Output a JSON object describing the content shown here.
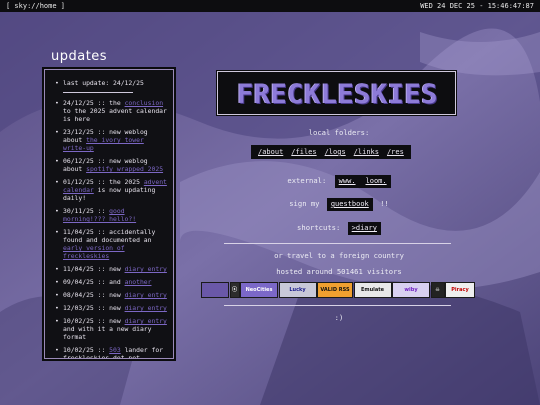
{
  "topbar": {
    "left": "[ sky://home ]",
    "right": "WED 24 DEC 25 - 15:46:47:87"
  },
  "sidebar": {
    "title": "updates",
    "last_update": "last update: 24/12/25",
    "items": [
      {
        "date": "24/12/25",
        "pre": " :: the ",
        "link": "conclusion",
        "post": " to the 2025 advent calendar is here"
      },
      {
        "date": "23/12/25",
        "pre": " :: new weblog about ",
        "link": "the ivory tower write-up",
        "post": ""
      },
      {
        "date": "06/12/25",
        "pre": " :: new weblog about ",
        "link": "spotify wrapped 2025",
        "post": ""
      },
      {
        "date": "01/12/25",
        "pre": " :: the 2025 ",
        "link": "advent calendar",
        "post": " is now updating daily!"
      },
      {
        "date": "30/11/25",
        "pre": " :: ",
        "link": "good morning!??? hello?!",
        "post": ""
      },
      {
        "date": "11/04/25",
        "pre": " :: accidentally found and documented an ",
        "link": "early version of freckleskies",
        "post": ""
      },
      {
        "date": "11/04/25",
        "pre": " :: new ",
        "link": "diary entry",
        "post": ""
      },
      {
        "date": "09/04/25",
        "pre": " :: and ",
        "link": "another",
        "post": ""
      },
      {
        "date": "08/04/25",
        "pre": " :: new ",
        "link": "diary entry",
        "post": ""
      },
      {
        "date": "12/03/25",
        "pre": " :: new ",
        "link": "diary entry",
        "post": ""
      },
      {
        "date": "10/02/25",
        "pre": " :: new ",
        "link": "diary entry",
        "post": " and with it a new diary format"
      },
      {
        "date": "10/02/25",
        "pre": " :: ",
        "link": "503",
        "post": " lander for freckleskies.dot.net"
      }
    ]
  },
  "logo": {
    "text": "FRECKLESKIES"
  },
  "main": {
    "local_folders_label": "local folders:",
    "folders": [
      "/about",
      "/files",
      "/logs",
      "/links",
      "/res"
    ],
    "external_label": "external:",
    "external_links": [
      "www.",
      "loom."
    ],
    "sign_label": "sign my",
    "guestbook": "guestbook",
    "sign_suffix": "!!",
    "shortcuts_label": "shortcuts:",
    "shortcut": ">diary",
    "travel": "or travel to a foreign country",
    "hosted": "hosted around 501461 visitors",
    "footer": ":)"
  },
  "badges": [
    {
      "label": "",
      "bg": "#6a58a8",
      "fg": "#ffffff"
    },
    {
      "label": "ⓢ",
      "bg": "#2c2c2c",
      "fg": "#ffffff"
    },
    {
      "label": "NeoCities",
      "bg": "#7b68c8",
      "fg": "#ffffff"
    },
    {
      "label": "Lucky",
      "bg": "#c8c8d8",
      "fg": "#1a1a8a"
    },
    {
      "label": "VALID RSS",
      "bg": "#f0a030",
      "fg": "#111111"
    },
    {
      "label": "Emulate",
      "bg": "#e8e8e8",
      "fg": "#111111"
    },
    {
      "label": "wiby",
      "bg": "#d8d0f0",
      "fg": "#7020c0"
    },
    {
      "label": "☠",
      "bg": "#222222",
      "fg": "#ffffff"
    },
    {
      "label": "Piracy",
      "bg": "#eeeeee",
      "fg": "#c00000"
    }
  ],
  "colors": {
    "bg": "#6a5f94",
    "panel": "#0d0d10",
    "link": "#7c67c4",
    "logo": "#8d7bd8"
  }
}
